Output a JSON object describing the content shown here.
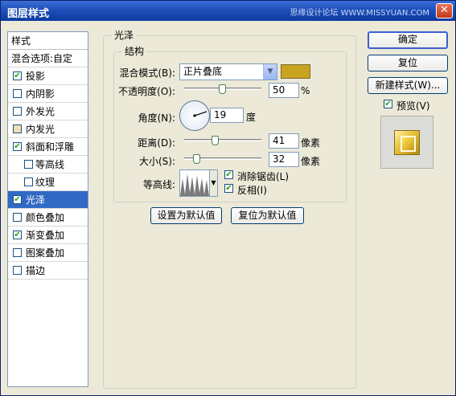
{
  "window": {
    "title": "图层样式",
    "watermark": "思缘设计论坛 WWW.MISSYUAN.COM"
  },
  "left": {
    "header": "样式",
    "blend_options": "混合选项:自定",
    "items": [
      {
        "label": "投影",
        "checked": true
      },
      {
        "label": "内阴影",
        "checked": false
      },
      {
        "label": "外发光",
        "checked": false
      },
      {
        "label": "内发光",
        "checked": false
      },
      {
        "label": "斜面和浮雕",
        "checked": true
      },
      {
        "label": "等高线",
        "checked": false
      },
      {
        "label": "纹理",
        "checked": false
      },
      {
        "label": "光泽",
        "checked": true
      },
      {
        "label": "颜色叠加",
        "checked": false
      },
      {
        "label": "渐变叠加",
        "checked": true
      },
      {
        "label": "图案叠加",
        "checked": false
      },
      {
        "label": "描边",
        "checked": false
      }
    ]
  },
  "satin": {
    "group_title": "光泽",
    "structure_title": "结构",
    "blend_mode_label": "混合模式(B):",
    "blend_mode_value": "正片叠底",
    "color": "#c8a420",
    "opacity_label": "不透明度(O):",
    "opacity_value": "50",
    "opacity_unit": "%",
    "angle_label": "角度(N):",
    "angle_value": "19",
    "angle_unit": "度",
    "distance_label": "距离(D):",
    "distance_value": "41",
    "distance_unit": "像素",
    "size_label": "大小(S):",
    "size_value": "32",
    "size_unit": "像素",
    "contour_label": "等高线:",
    "anti_alias_label": "消除锯齿(L)",
    "anti_alias_checked": true,
    "invert_label": "反相(I)",
    "invert_checked": true,
    "make_default": "设置为默认值",
    "reset_default": "复位为默认值"
  },
  "buttons": {
    "ok": "确定",
    "reset": "复位",
    "new_style": "新建样式(W)...",
    "preview_label": "预览(V)",
    "preview_checked": true
  }
}
